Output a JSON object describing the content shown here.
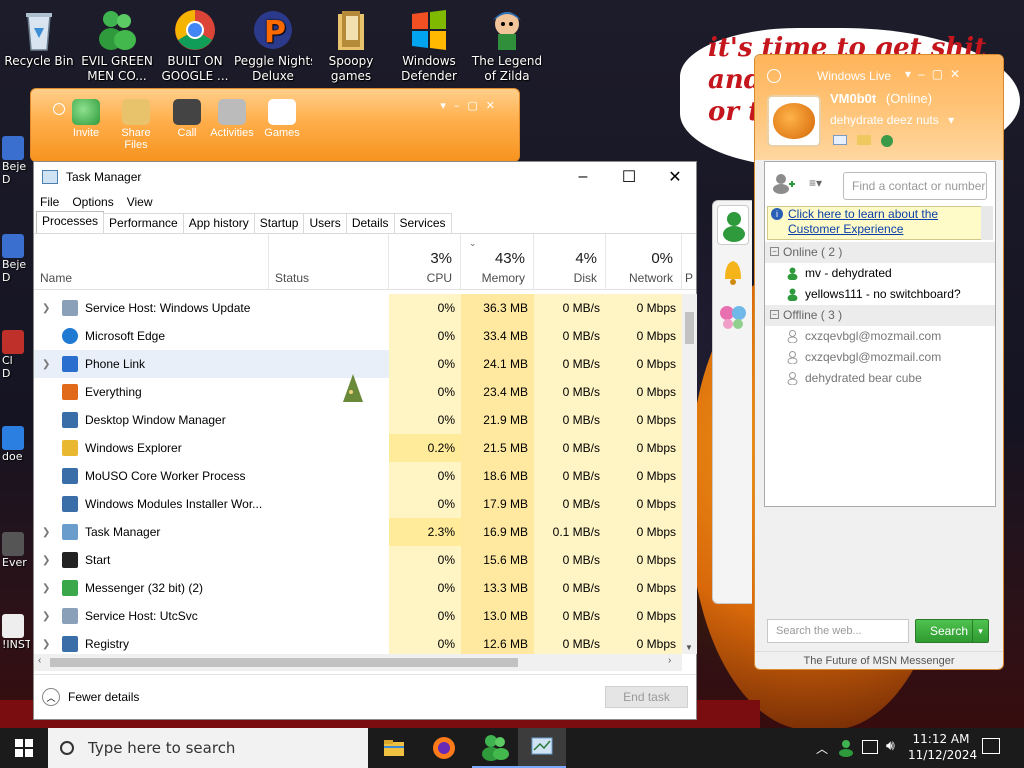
{
  "desktop": {
    "top_icons": [
      {
        "label1": "Recycle Bin",
        "label2": ""
      },
      {
        "label1": "EVIL GREEN",
        "label2": "MEN CO..."
      },
      {
        "label1": "BUILT ON",
        "label2": "GOOGLE ..."
      },
      {
        "label1": "Peggle Nights",
        "label2": "Deluxe"
      },
      {
        "label1": "Spoopy",
        "label2": "games"
      },
      {
        "label1": "Windows",
        "label2": "Defender"
      },
      {
        "label1": "The Legend",
        "label2": "of Zilda"
      }
    ],
    "side_icons": [
      {
        "label1": "Beje",
        "label2": "D"
      },
      {
        "label1": "Beje",
        "label2": "D"
      },
      {
        "label1": "Cl",
        "label2": "D"
      },
      {
        "label1": "doe",
        "label2": ""
      },
      {
        "label1": "Ever",
        "label2": ""
      },
      {
        "label1": "!INST",
        "label2": ""
      }
    ],
    "wallpaper_text": [
      "it's time to get shit",
      "and",
      "or t"
    ]
  },
  "messenger_toolbar": {
    "buttons": [
      "Invite",
      "Share Files",
      "Call",
      "Activities",
      "Games"
    ]
  },
  "task_manager": {
    "title": "Task Manager",
    "menu": [
      "File",
      "Options",
      "View"
    ],
    "tabs": [
      "Processes",
      "Performance",
      "App history",
      "Startup",
      "Users",
      "Details",
      "Services"
    ],
    "columns": {
      "name": "Name",
      "status": "Status",
      "cpu": {
        "pct": "3%",
        "label": "CPU"
      },
      "memory": {
        "pct": "43%",
        "label": "Memory"
      },
      "disk": {
        "pct": "4%",
        "label": "Disk"
      },
      "network": {
        "pct": "0%",
        "label": "Network"
      },
      "power": "P"
    },
    "rows": [
      {
        "name": "Service Host: Windows Update",
        "cpu": "0%",
        "mem": "36.3 MB",
        "disk": "0 MB/s",
        "net": "0 Mbps",
        "exp": true,
        "icon": "gear"
      },
      {
        "name": "Microsoft Edge",
        "cpu": "0%",
        "mem": "33.4 MB",
        "disk": "0 MB/s",
        "net": "0 Mbps",
        "exp": false,
        "icon": "edge"
      },
      {
        "name": "Phone Link",
        "cpu": "0%",
        "mem": "24.1 MB",
        "disk": "0 MB/s",
        "net": "0 Mbps",
        "exp": true,
        "icon": "phone"
      },
      {
        "name": "Everything",
        "cpu": "0%",
        "mem": "23.4 MB",
        "disk": "0 MB/s",
        "net": "0 Mbps",
        "exp": false,
        "icon": "search"
      },
      {
        "name": "Desktop Window Manager",
        "cpu": "0%",
        "mem": "21.9 MB",
        "disk": "0 MB/s",
        "net": "0 Mbps",
        "exp": false,
        "icon": "window"
      },
      {
        "name": "Windows Explorer",
        "cpu": "0.2%",
        "mem": "21.5 MB",
        "disk": "0 MB/s",
        "net": "0 Mbps",
        "exp": false,
        "icon": "folder"
      },
      {
        "name": "MoUSO Core Worker Process",
        "cpu": "0%",
        "mem": "18.6 MB",
        "disk": "0 MB/s",
        "net": "0 Mbps",
        "exp": false,
        "icon": "window"
      },
      {
        "name": "Windows Modules Installer Wor...",
        "cpu": "0%",
        "mem": "17.9 MB",
        "disk": "0 MB/s",
        "net": "0 Mbps",
        "exp": false,
        "icon": "window"
      },
      {
        "name": "Task Manager",
        "cpu": "2.3%",
        "mem": "16.9 MB",
        "disk": "0.1 MB/s",
        "net": "0 Mbps",
        "exp": true,
        "icon": "taskmgr"
      },
      {
        "name": "Start",
        "cpu": "0%",
        "mem": "15.6 MB",
        "disk": "0 MB/s",
        "net": "0 Mbps",
        "exp": true,
        "icon": "start"
      },
      {
        "name": "Messenger (32 bit) (2)",
        "cpu": "0%",
        "mem": "13.3 MB",
        "disk": "0 MB/s",
        "net": "0 Mbps",
        "exp": true,
        "icon": "messenger"
      },
      {
        "name": "Service Host: UtcSvc",
        "cpu": "0%",
        "mem": "13.0 MB",
        "disk": "0 MB/s",
        "net": "0 Mbps",
        "exp": true,
        "icon": "gear"
      },
      {
        "name": "Registry",
        "cpu": "0%",
        "mem": "12.6 MB",
        "disk": "0 MB/s",
        "net": "0 Mbps",
        "exp": true,
        "icon": "window"
      }
    ],
    "selected_row": 2,
    "fewer_details": "Fewer details",
    "end_task": "End task"
  },
  "messenger": {
    "title": "Windows Live",
    "username": "VM0b0t",
    "status": "(Online)",
    "personal_message": "dehydrate deez nuts",
    "search_contacts_placeholder": "Find a contact or number",
    "info_banner": [
      "Click here to learn about the",
      "Customer Experience"
    ],
    "online_group": "Online ( 2 )",
    "online_contacts": [
      "mv - dehydrated",
      "yellows111 - no switchboard?"
    ],
    "offline_group": "Offline ( 3 )",
    "offline_contacts": [
      "cxzqevbgl@mozmail.com",
      "cxzqevbgl@mozmail.com",
      "dehydrated bear cube"
    ],
    "web_search_placeholder": "Search the web...",
    "search_button": "Search",
    "footer": "The Future of MSN Messenger"
  },
  "taskbar": {
    "search_placeholder": "Type here to search",
    "time": "11:12 AM",
    "date": "11/12/2024"
  },
  "colors": {
    "accent_orange": "#f7931e",
    "cpu_heat": "#fff4c4",
    "mem_heat": "#ffeaa0",
    "search_green": "#2f9a31"
  }
}
